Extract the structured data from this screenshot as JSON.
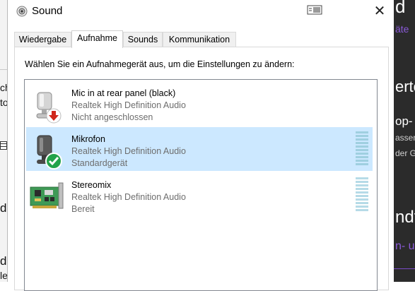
{
  "window": {
    "title": "Sound"
  },
  "tabs": [
    {
      "label": "Wiedergabe",
      "active": false
    },
    {
      "label": "Aufnahme",
      "active": true
    },
    {
      "label": "Sounds",
      "active": false
    },
    {
      "label": "Kommunikation",
      "active": false
    }
  ],
  "instruction": "Wählen Sie ein Aufnahmegerät aus, um die Einstellungen zu ändern:",
  "devices": [
    {
      "name": "Mic in at rear panel (black)",
      "driver": "Realtek High Definition Audio",
      "status": "Nicht angeschlossen",
      "icon": "microphone-disconnected-icon",
      "selected": false
    },
    {
      "name": "Mikrofon",
      "driver": "Realtek High Definition Audio",
      "status": "Standardgerät",
      "icon": "microphone-default-icon",
      "selected": true
    },
    {
      "name": "Stereomix",
      "driver": "Realtek High Definition Audio",
      "status": "Bereit",
      "icon": "sound-card-icon",
      "selected": false
    }
  ],
  "background": {
    "right_fragments": [
      "d",
      "äte",
      "erte",
      "op-",
      "asser",
      "der G",
      "ndt",
      "n- u"
    ],
    "left_fragments": [
      "ch",
      "to",
      "d",
      "d",
      "le"
    ]
  },
  "colors": {
    "selection": "#cce8ff",
    "meter": "#b6dbe7",
    "accent_purple": "#7a4cc7",
    "status_green": "#22a34a",
    "status_red": "#d0261b"
  }
}
